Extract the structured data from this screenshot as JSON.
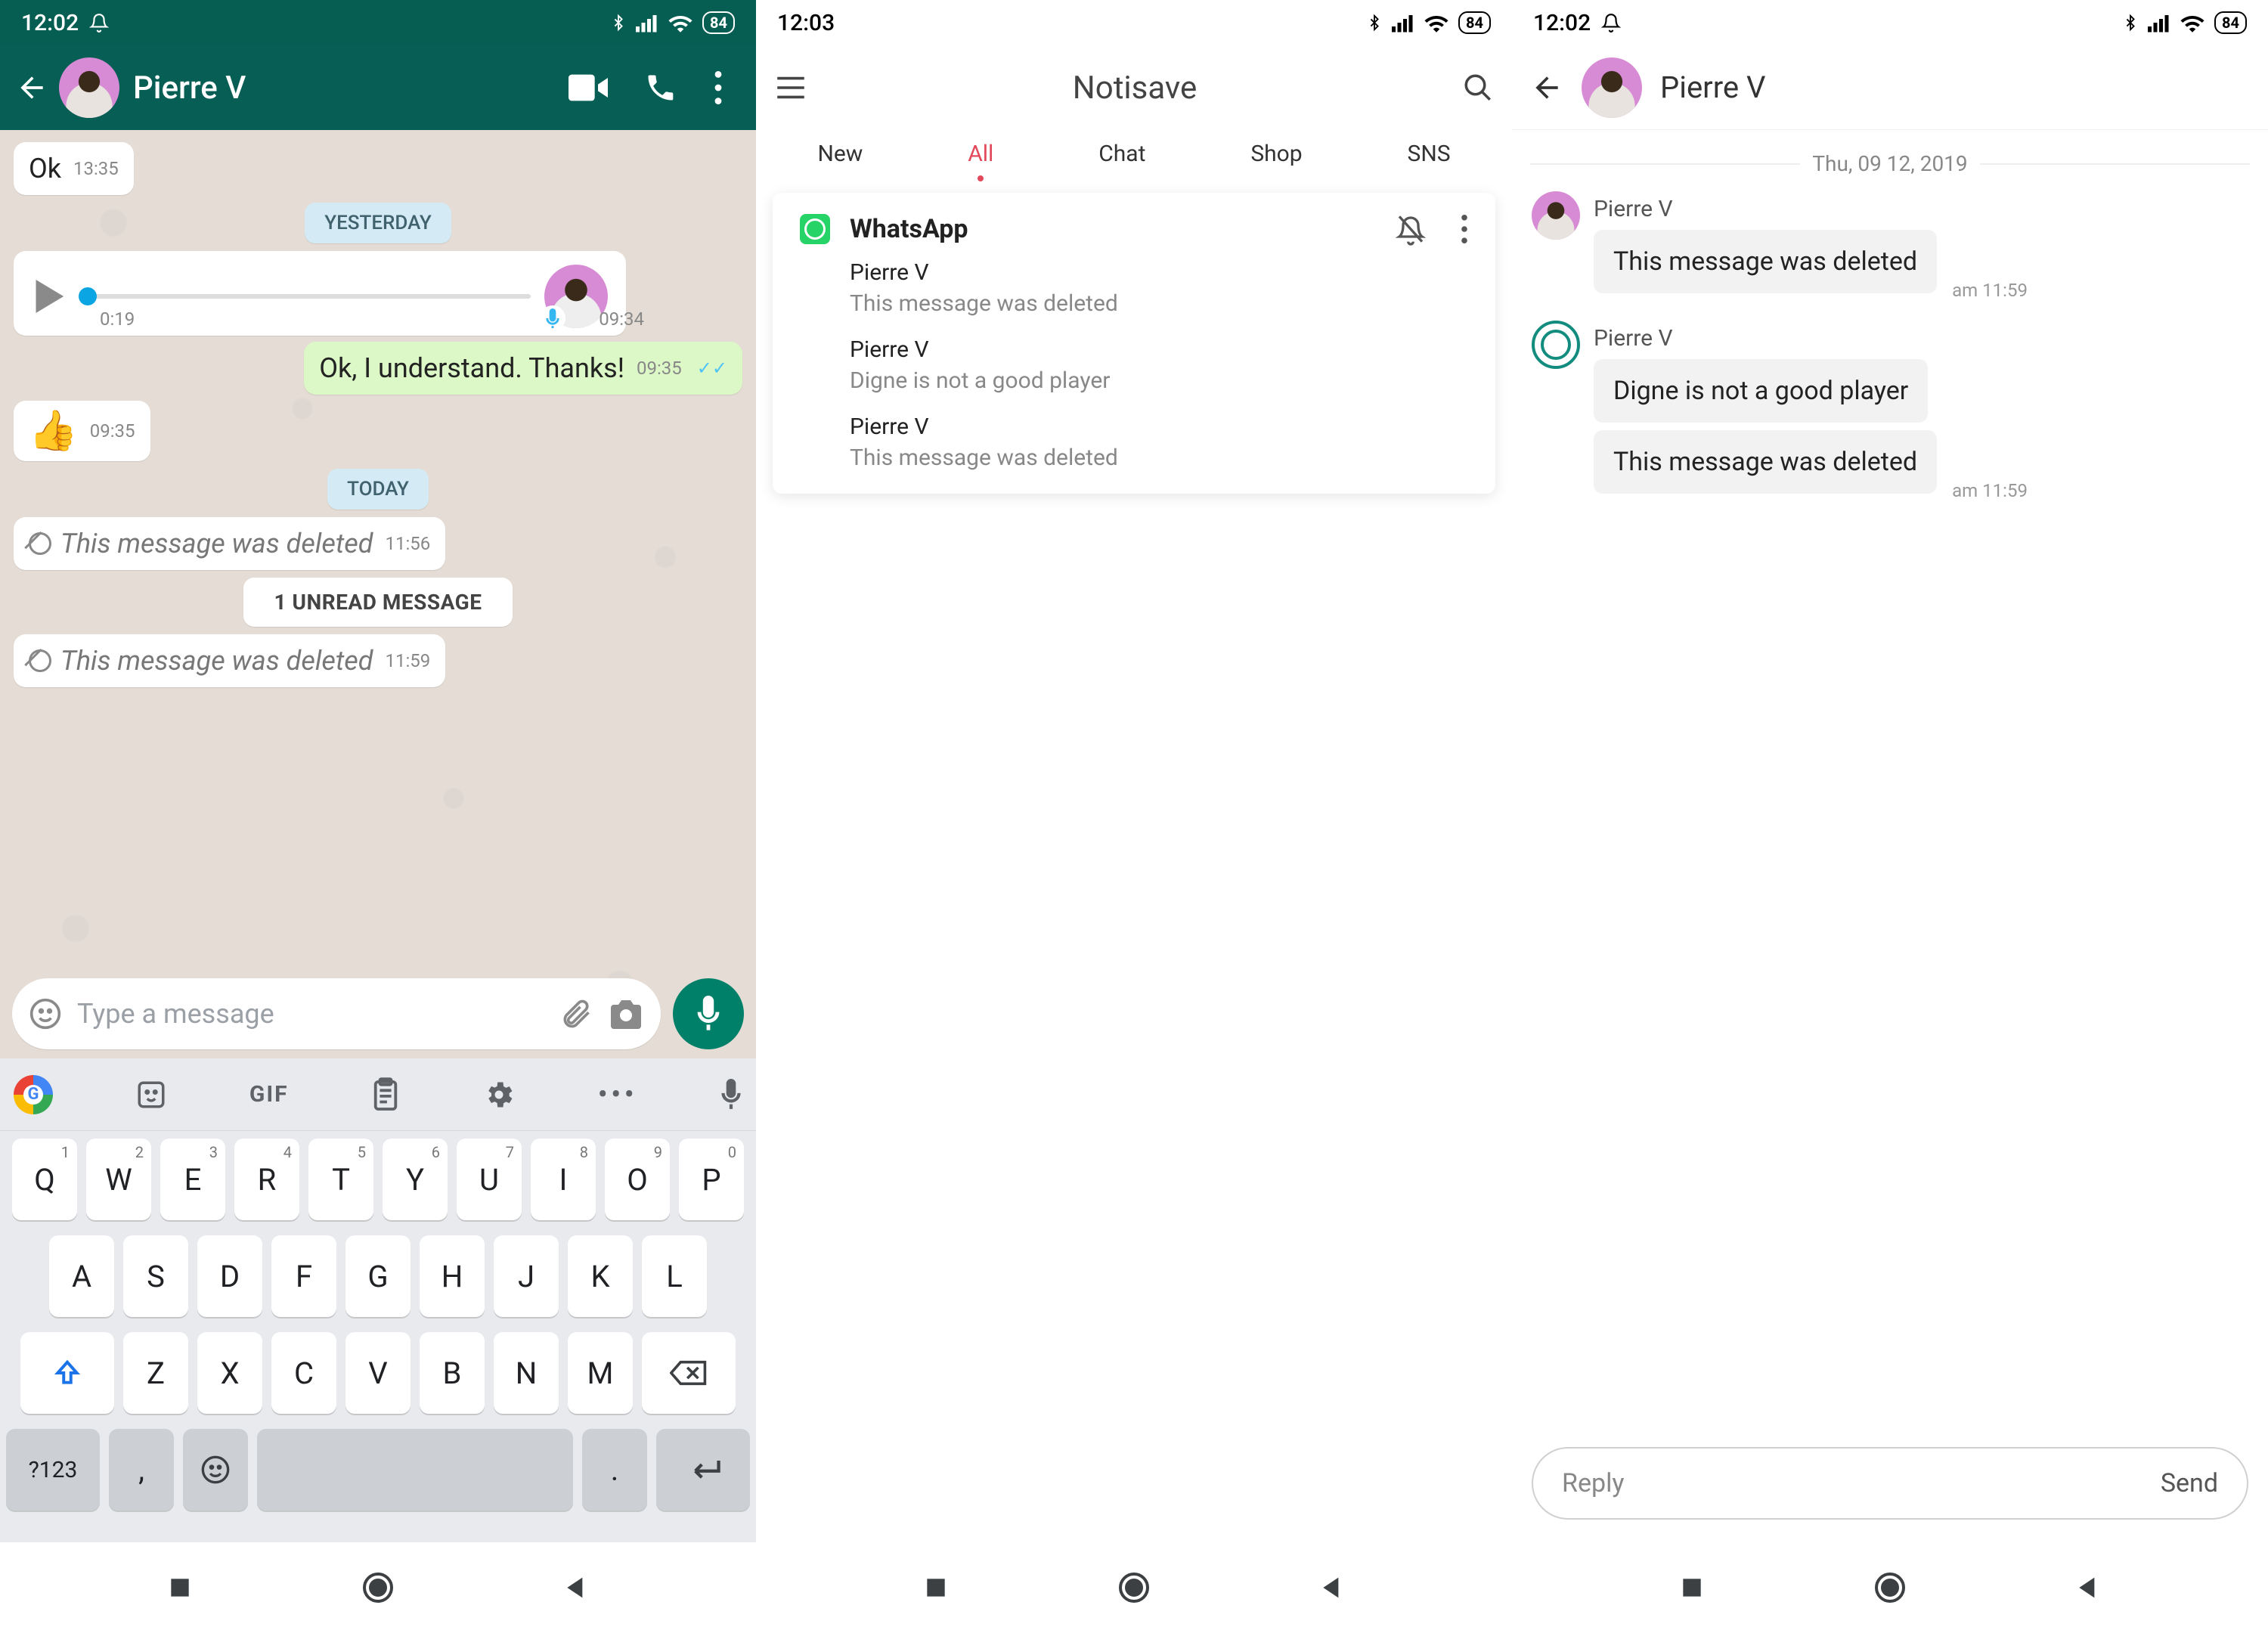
{
  "status": {
    "time1": "12:02",
    "time2": "12:03",
    "time3": "12:02",
    "battery": "84"
  },
  "phone1": {
    "contact": "Pierre V",
    "composer_placeholder": "Type a message",
    "chips": {
      "yesterday": "YESTERDAY",
      "today": "TODAY",
      "unread": "1 UNREAD MESSAGE"
    },
    "msgs": {
      "m0": {
        "text": "Ok",
        "time": "13:35"
      },
      "voice": {
        "pos": "0:19",
        "time": "09:34"
      },
      "m1": {
        "text": "Ok, I understand. Thanks!",
        "time": "09:35"
      },
      "m2": {
        "emoji": "👍",
        "time": "09:35"
      },
      "m3": {
        "text": "This message was deleted",
        "time": "11:56"
      },
      "m4": {
        "text": "This message was deleted",
        "time": "11:59"
      }
    },
    "keys": {
      "row1": [
        "Q",
        "W",
        "E",
        "R",
        "T",
        "Y",
        "U",
        "I",
        "O",
        "P"
      ],
      "row1sup": [
        "1",
        "2",
        "3",
        "4",
        "5",
        "6",
        "7",
        "8",
        "9",
        "0"
      ],
      "row2": [
        "A",
        "S",
        "D",
        "F",
        "G",
        "H",
        "J",
        "K",
        "L"
      ],
      "row3": [
        "Z",
        "X",
        "C",
        "V",
        "B",
        "N",
        "M"
      ],
      "fn": "?123",
      "gif": "GIF"
    }
  },
  "phone2": {
    "title": "Notisave",
    "tabs": {
      "new": "New",
      "all": "All",
      "chat": "Chat",
      "shop": "Shop",
      "sns": "SNS"
    },
    "card": {
      "app": "WhatsApp",
      "items": [
        {
          "sender": "Pierre V",
          "body": "This message was deleted"
        },
        {
          "sender": "Pierre V",
          "body": "Digne is not a good player"
        },
        {
          "sender": "Pierre V",
          "body": "This message was deleted"
        }
      ]
    }
  },
  "phone3": {
    "contact": "Pierre V",
    "date": "Thu, 09 12, 2019",
    "reply_placeholder": "Reply",
    "send": "Send",
    "groups": [
      {
        "avatar": "pink",
        "sender": "Pierre V",
        "msgs": [
          {
            "text": "This message was deleted",
            "time": "am 11:59"
          }
        ]
      },
      {
        "avatar": "wa",
        "sender": "Pierre V",
        "msgs": [
          {
            "text": "Digne is not a good player"
          },
          {
            "text": "This message was deleted",
            "time": "am 11:59"
          }
        ]
      }
    ]
  }
}
